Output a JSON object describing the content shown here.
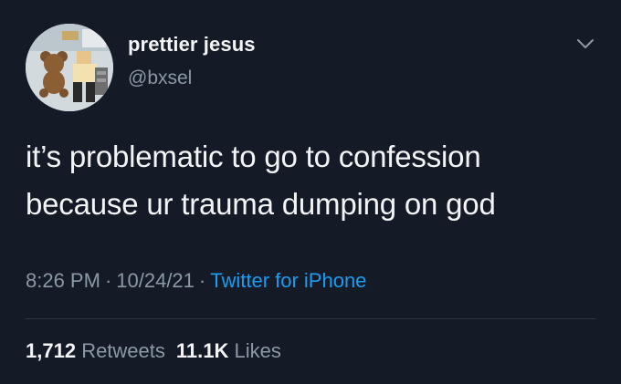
{
  "user": {
    "display_name": "prettier jesus",
    "handle": "@bxsel"
  },
  "tweet": {
    "lines": [
      "it’s problematic to go to confession",
      "because ur trauma dumping on god"
    ],
    "time": "8:26 PM",
    "separator": "·",
    "date": "10/24/21",
    "source": "Twitter for iPhone"
  },
  "stats": {
    "retweets_count": "1,712",
    "retweets_label": "Retweets",
    "likes_count": "11.1K",
    "likes_label": "Likes"
  },
  "icons": {
    "menu": "chevron-down-icon",
    "avatar": "avatar-image"
  },
  "colors": {
    "background": "#151b26",
    "text": "#f2f4f6",
    "secondary": "#8b98a5",
    "link": "#1d9bf0"
  }
}
